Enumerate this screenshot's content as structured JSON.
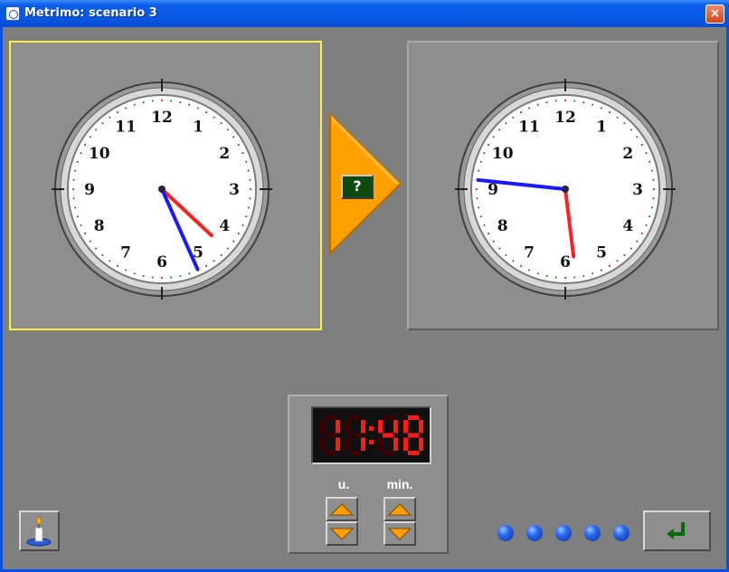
{
  "window": {
    "title": "Metrimo: scenario 3",
    "close_glyph": "×"
  },
  "icons": {
    "app": "app-icon",
    "close": "close-icon",
    "help": "candle-icon",
    "enter": "enter-arrow-icon",
    "up": "triangle-up-icon",
    "down": "triangle-down-icon"
  },
  "clock_numbers": [
    "12",
    "1",
    "2",
    "3",
    "4",
    "5",
    "6",
    "7",
    "8",
    "9",
    "10",
    "11"
  ],
  "clock_left": {
    "hours": 4,
    "minutes": 26
  },
  "clock_right": {
    "hours": 5,
    "minutes": 46
  },
  "question_label": "?",
  "digital": {
    "hours": "11",
    "minutes": "48"
  },
  "labels": {
    "hours": "u.",
    "minutes": "min."
  },
  "progress": {
    "total": 5,
    "completed": 0
  },
  "colors": {
    "hour_hand": "#ff2020",
    "minute_hand": "#1a1aff",
    "arrow": "#ffa000",
    "selected_border": "#ffee44",
    "digits_on": "#ff1a1a",
    "digits_off": "#3a0000",
    "dot": "#2a6cf0"
  }
}
